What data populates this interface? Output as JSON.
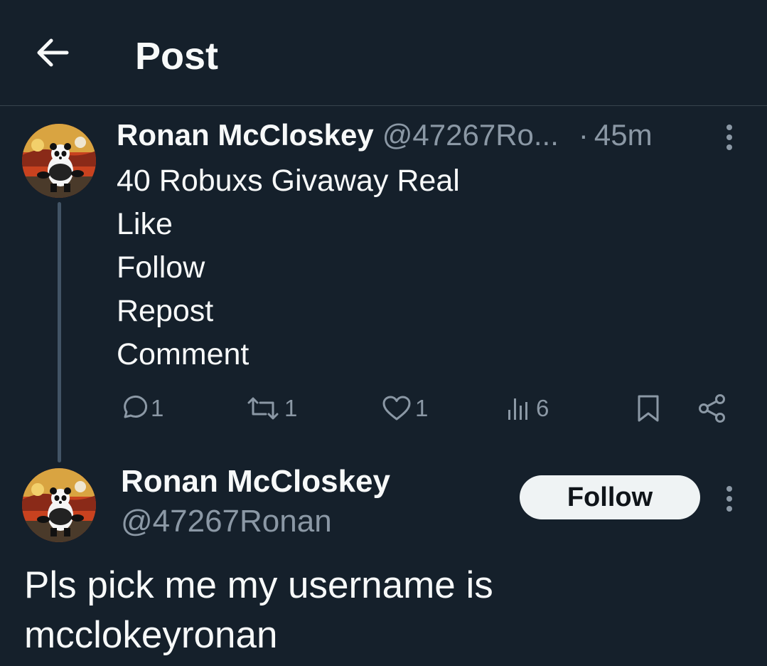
{
  "header": {
    "title": "Post",
    "back_icon": "arrow-left-icon"
  },
  "parent_tweet": {
    "author_name": "Ronan McCloskey",
    "author_handle": "@47267Ro...",
    "time_separator": "·",
    "timestamp": "45m",
    "body_lines": [
      "40 Robuxs Givaway Real",
      "Like",
      "Follow",
      "Repost",
      "Comment"
    ],
    "actions": {
      "reply_count": "1",
      "repost_count": "1",
      "like_count": "1",
      "views_count": "6"
    }
  },
  "reply": {
    "author_name": "Ronan McCloskey",
    "author_handle": "@47267Ronan",
    "follow_label": "Follow",
    "text_lines": [
      "Pls pick me my username is",
      "mcclokeyronan"
    ]
  },
  "colors": {
    "background": "#15202b",
    "text_primary": "#f7f9f9",
    "text_secondary": "#8b98a5",
    "divider": "#38444d",
    "follow_button_bg": "#eff3f4",
    "follow_button_text": "#0f1419"
  }
}
